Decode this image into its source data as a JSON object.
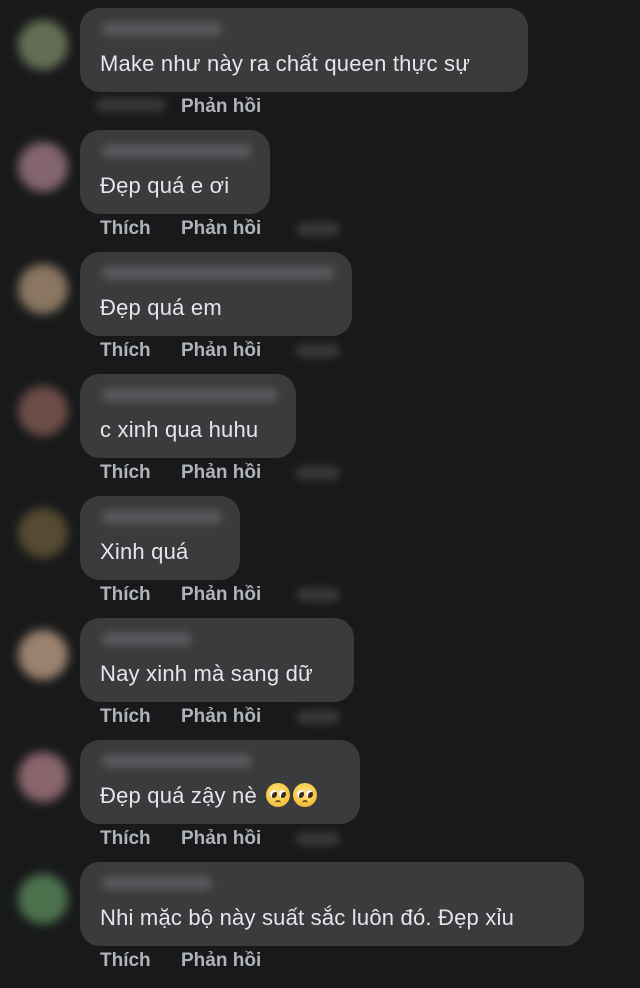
{
  "actions": {
    "like_label": "Thích",
    "reply_label": "Phản hồi"
  },
  "comments": [
    {
      "text": "Make như này ra chất queen thực sự"
    },
    {
      "text": "Đẹp quá e ơi"
    },
    {
      "text": "Đẹp quá em"
    },
    {
      "text": "c xinh qua huhu"
    },
    {
      "text": "Xinh quá"
    },
    {
      "text": "Nay xinh mà sang dữ"
    },
    {
      "text": "Đẹp quá zậy nè",
      "emojis": [
        "pleading-face-icon",
        "pleading-face-icon"
      ]
    },
    {
      "text": "Nhi mặc bộ này suất sắc luôn đó. Đẹp xỉu"
    }
  ],
  "colors": {
    "background": "#18191a",
    "bubble": "#3a3b3c",
    "text": "#e4e6eb",
    "action_text": "#b0b3b8"
  }
}
